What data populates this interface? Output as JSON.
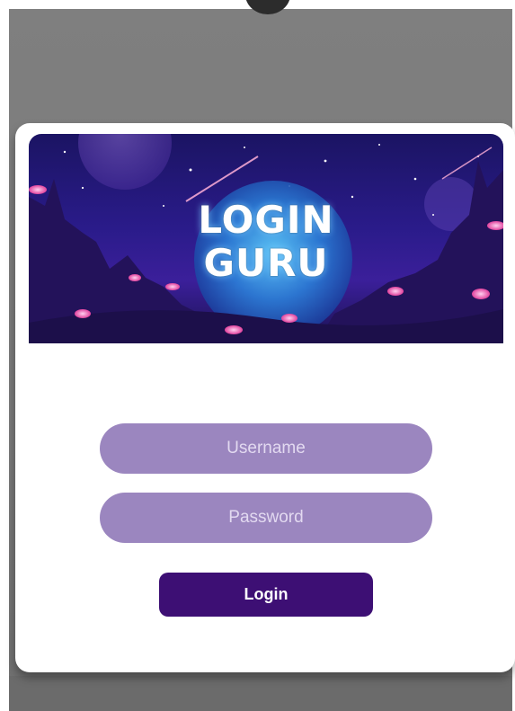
{
  "login_card": {
    "banner_title_line1": "LOGIN",
    "banner_title_line2": "GURU",
    "username_placeholder": "Username",
    "password_placeholder": "Password",
    "login_label": "Login"
  },
  "colors": {
    "field_background": "#9b86bf",
    "button_background": "#3d0f74",
    "banner_sky": "#2a1b8a"
  }
}
